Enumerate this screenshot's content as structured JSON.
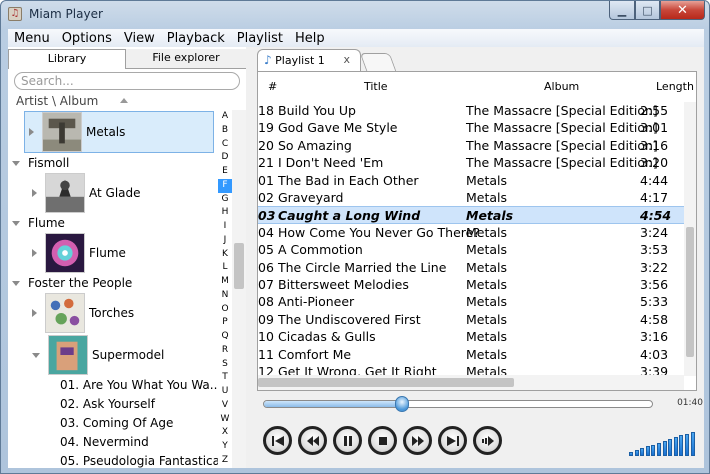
{
  "window": {
    "title": "Miam Player",
    "app_icon": "miam-icon"
  },
  "menu": [
    "Menu",
    "Options",
    "View",
    "Playback",
    "Playlist",
    "Help"
  ],
  "left_tabs": {
    "library": "Library",
    "file_explorer": "File explorer"
  },
  "search": {
    "placeholder": "Search..."
  },
  "sort_label": "Artist \\ Album",
  "tree": {
    "first_album": "Metals",
    "artists": [
      {
        "name": "Fismoll",
        "album": "At Glade"
      },
      {
        "name": "Flume",
        "album": "Flume"
      },
      {
        "name": "Foster the People",
        "albums": [
          "Torches",
          "Supermodel"
        ]
      }
    ],
    "tracks": [
      "01. Are You What You Wa...",
      "02. Ask Yourself",
      "03. Coming Of Age",
      "04. Nevermind",
      "05. Pseudologia Fantastica"
    ]
  },
  "alphabet": [
    "A",
    "B",
    "C",
    "D",
    "E",
    "F",
    "G",
    "H",
    "I",
    "J",
    "K",
    "L",
    "M",
    "N",
    "O",
    "P",
    "Q",
    "R",
    "S",
    "T",
    "U",
    "V",
    "W",
    "X",
    "Y",
    "Z"
  ],
  "alphabet_highlight": "F",
  "playlist_tab": "Playlist 1",
  "playlist_close": "x",
  "columns": {
    "num": "#",
    "title": "Title",
    "album": "Album",
    "length": "Length"
  },
  "tracks": [
    {
      "n": "18",
      "title": "Build You Up",
      "album": "The Massacre [Special Edition]",
      "len": "2:55"
    },
    {
      "n": "19",
      "title": "God Gave Me Style",
      "album": "The Massacre [Special Edition]",
      "len": "3:01"
    },
    {
      "n": "20",
      "title": "So Amazing",
      "album": "The Massacre [Special Edition]",
      "len": "3:16"
    },
    {
      "n": "21",
      "title": "I Don't Need 'Em",
      "album": "The Massacre [Special Edition]",
      "len": "3:20"
    },
    {
      "n": "01",
      "title": "The Bad in Each Other",
      "album": "Metals",
      "len": "4:44"
    },
    {
      "n": "02",
      "title": "Graveyard",
      "album": "Metals",
      "len": "4:17"
    },
    {
      "n": "03",
      "title": "Caught a Long Wind",
      "album": "Metals",
      "len": "4:54"
    },
    {
      "n": "04",
      "title": "How Come You Never Go There?",
      "album": "Metals",
      "len": "3:24"
    },
    {
      "n": "05",
      "title": "A Commotion",
      "album": "Metals",
      "len": "3:53"
    },
    {
      "n": "06",
      "title": "The Circle Married the Line",
      "album": "Metals",
      "len": "3:22"
    },
    {
      "n": "07",
      "title": "Bittersweet Melodies",
      "album": "Metals",
      "len": "3:56"
    },
    {
      "n": "08",
      "title": "Anti-Pioneer",
      "album": "Metals",
      "len": "5:33"
    },
    {
      "n": "09",
      "title": "The Undiscovered First",
      "album": "Metals",
      "len": "4:58"
    },
    {
      "n": "10",
      "title": "Cicadas & Gulls",
      "album": "Metals",
      "len": "3:16"
    },
    {
      "n": "11",
      "title": "Comfort Me",
      "album": "Metals",
      "len": "4:03"
    },
    {
      "n": "12",
      "title": "Get It Wrong, Get It Right",
      "album": "Metals",
      "len": "3:39"
    }
  ],
  "current_track_index": 6,
  "seek": {
    "position_fraction": 0.35,
    "time": "01:40"
  },
  "controls": [
    "skip-back-icon",
    "rewind-icon",
    "pause-icon",
    "stop-icon",
    "fast-forward-icon",
    "skip-forward-icon",
    "shuffle-icon"
  ],
  "volume_level": 1.0
}
